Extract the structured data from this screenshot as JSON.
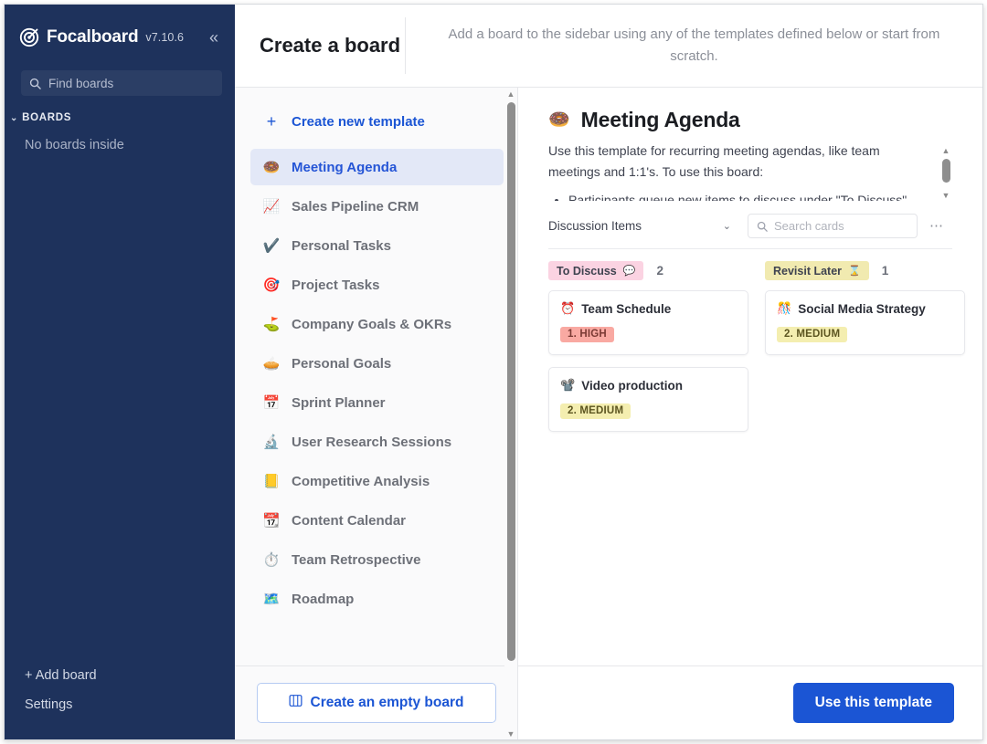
{
  "sidebar": {
    "logo_text": "Focalboard",
    "version": "v7.10.6",
    "collapse_icon": "«",
    "search_placeholder": "Find boards",
    "search_value": "",
    "boards_section_label": "BOARDS",
    "boards_caret": "⌄",
    "empty_text": "No boards inside",
    "add_board_label": "+ Add board",
    "settings_label": "Settings",
    "bg_color": "#1e325c"
  },
  "dialog": {
    "title": "Create a board",
    "subtitle": "Add a board to the sidebar using any of the templates defined below or start from scratch.",
    "create_empty_label": "Create an empty board",
    "use_template_label": "Use this template",
    "accent_color": "#1b55d4"
  },
  "templates": {
    "create_new_label": "Create new template",
    "create_new_icon": "+",
    "items": [
      {
        "icon": "🍩",
        "label": "Meeting Agenda",
        "selected": true
      },
      {
        "icon": "📈",
        "label": "Sales Pipeline CRM",
        "selected": false
      },
      {
        "icon": "✔️",
        "label": "Personal Tasks",
        "selected": false
      },
      {
        "icon": "🎯",
        "label": "Project Tasks",
        "selected": false
      },
      {
        "icon": "⛳",
        "label": "Company Goals & OKRs",
        "selected": false
      },
      {
        "icon": "🥧",
        "label": "Personal Goals",
        "selected": false
      },
      {
        "icon": "📅",
        "label": "Sprint Planner",
        "selected": false
      },
      {
        "icon": "🔬",
        "label": "User Research Sessions",
        "selected": false
      },
      {
        "icon": "📒",
        "label": "Competitive Analysis",
        "selected": false
      },
      {
        "icon": "📆",
        "label": "Content Calendar",
        "selected": false
      },
      {
        "icon": "⏱️",
        "label": "Team Retrospective",
        "selected": false
      },
      {
        "icon": "🗺️",
        "label": "Roadmap",
        "selected": false
      }
    ]
  },
  "preview": {
    "emoji": "🍩",
    "title": "Meeting Agenda",
    "description_p1": "Use this template for recurring meeting agendas, like team meetings and 1:1's. To use this board:",
    "description_bullets": [
      "Participants queue new items to discuss under \"To Discuss\""
    ],
    "view_name": "Discussion Items",
    "view_chevron": "⌄",
    "search_placeholder": "Search cards",
    "search_value": "",
    "more_icon": "⋯",
    "columns": [
      {
        "name": "To Discuss",
        "emoji": "💬",
        "color": "#fbd3e2",
        "count": "2",
        "cards": [
          {
            "emoji": "⏰",
            "title": "Team Schedule",
            "property": "1. HIGH",
            "prop_bg": "#f9a9a2",
            "prop_fg": "#7a3a34"
          },
          {
            "emoji": "📽️",
            "title": "Video production",
            "property": "2. MEDIUM",
            "prop_bg": "#f4eeb0",
            "prop_fg": "#5c5520"
          }
        ]
      },
      {
        "name": "Revisit Later",
        "emoji": "⌛",
        "color": "#f1eab0",
        "count": "1",
        "cards": [
          {
            "emoji": "🎊",
            "title": "Social Media Strategy",
            "property": "2. MEDIUM",
            "prop_bg": "#f4eeb0",
            "prop_fg": "#5c5520"
          }
        ]
      }
    ]
  }
}
